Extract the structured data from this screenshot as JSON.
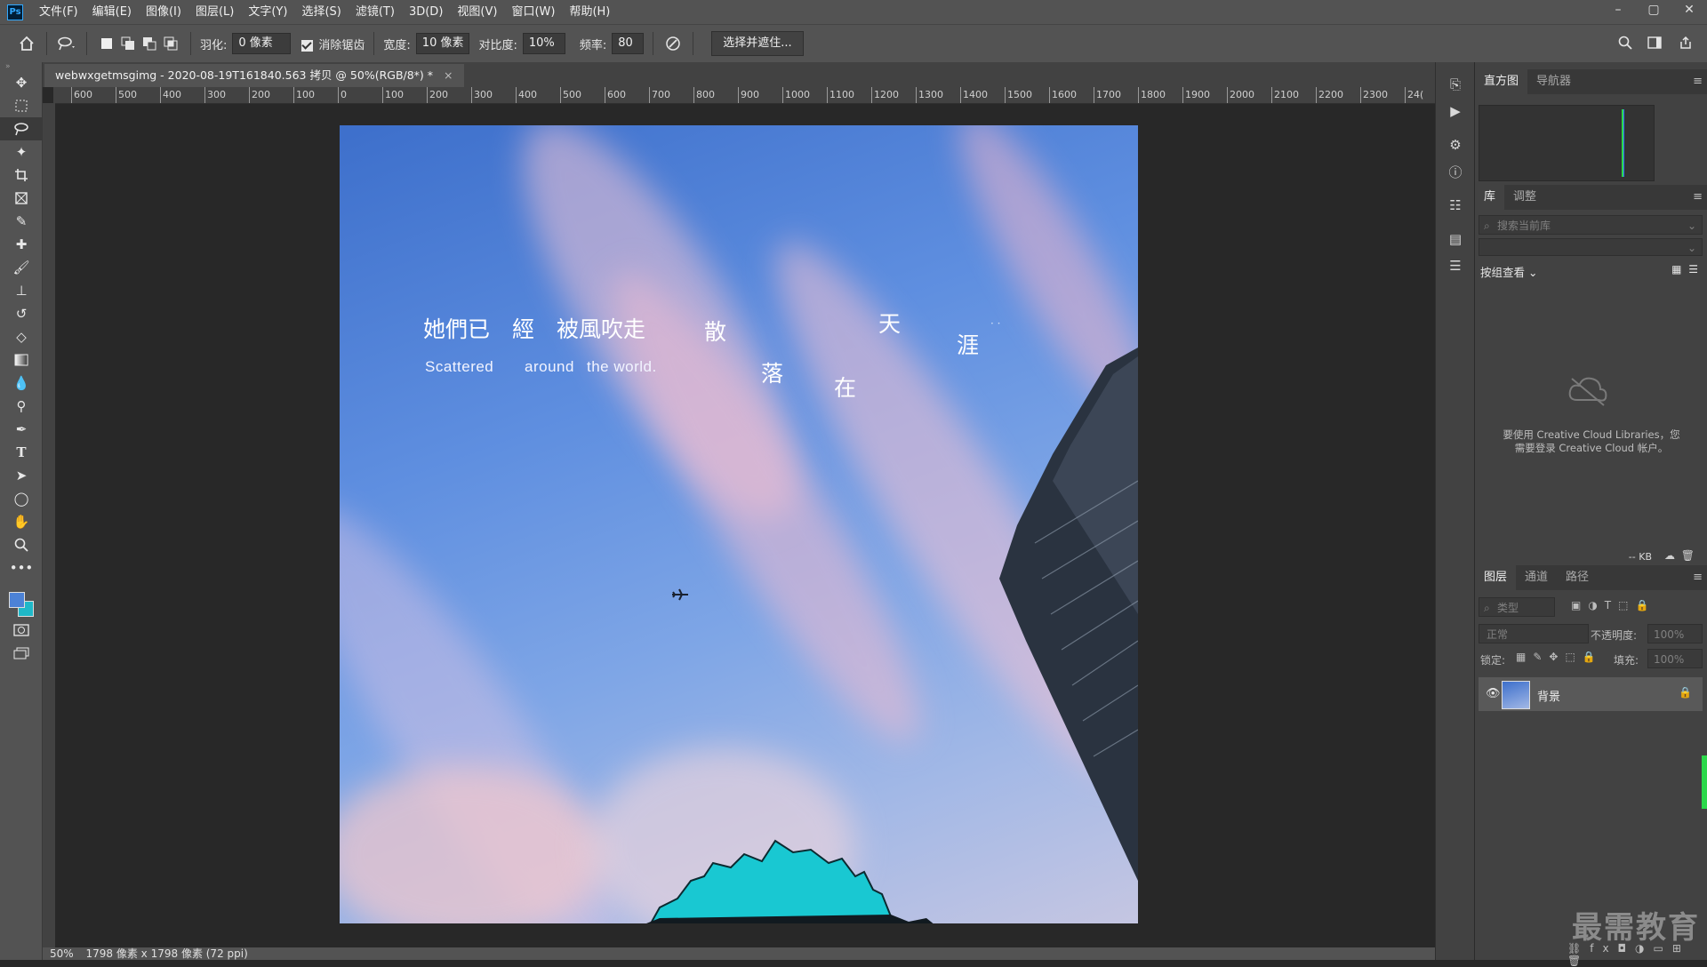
{
  "app": {
    "logo": "Ps"
  },
  "menubar": {
    "items": [
      "文件(F)",
      "编辑(E)",
      "图像(I)",
      "图层(L)",
      "文字(Y)",
      "选择(S)",
      "滤镜(T)",
      "3D(D)",
      "视图(V)",
      "窗口(W)",
      "帮助(H)"
    ],
    "window_buttons": [
      "–",
      "▢",
      "✕"
    ]
  },
  "options": {
    "feather_label": "羽化:",
    "feather_value": "0 像素",
    "antialias_label": "消除锯齿",
    "width_label": "宽度:",
    "width_value": "10 像素",
    "contrast_label": "对比度:",
    "contrast_value": "10%",
    "frequency_label": "频率:",
    "frequency_value": "80",
    "select_mask_button": "选择并遮住..."
  },
  "document": {
    "tab_title": "webwxgetmsgimg - 2020-08-19T161840.563 拷贝 @ 50%(RGB/8*) *",
    "tab_close": "×"
  },
  "ruler": {
    "top_labels": [
      "600",
      "500",
      "400",
      "300",
      "200",
      "100",
      "0",
      "100",
      "200",
      "300",
      "400",
      "500",
      "600",
      "700",
      "800",
      "900",
      "1000",
      "1100",
      "1200",
      "1300",
      "1400",
      "1500",
      "1600",
      "1700",
      "1800",
      "1900",
      "2000",
      "2100",
      "2200",
      "2300",
      "24("
    ]
  },
  "artwork": {
    "poem_cn_line1": "她們已　經　被風吹走",
    "poem_en_1": "Scattered",
    "poem_en_2": "around",
    "poem_en_3": "the world.",
    "char_san": "散",
    "char_luo": "落",
    "char_zai": "在",
    "char_tian": "天",
    "char_ya": "涯",
    "char_dots": "· ·",
    "colors": {
      "sky_top": "#3d6fcb",
      "selection_fill": "#19c8d2",
      "cloud_pink": "#e8b4c8"
    }
  },
  "status": {
    "zoom": "50%",
    "doc_info": "1798 像素 x 1798 像素 (72 ppi)"
  },
  "panels": {
    "top_tabs": [
      "直方图",
      "导航器"
    ],
    "library_tabs": [
      "库",
      "调整"
    ],
    "library_search_placeholder": "搜索当前库",
    "group_view": "按组查看",
    "cc_message_line1": "要使用 Creative Cloud Libraries，您",
    "cc_message_line2": "需要登录 Creative Cloud 帐户。",
    "kb_label": "-- KB",
    "layers_tabs": [
      "图层",
      "通道",
      "路径"
    ],
    "layer_filter": "类型",
    "blend_mode": "正常",
    "opacity_label": "不透明度:",
    "opacity_value": "100%",
    "lock_label": "锁定:",
    "fill_label": "填充:",
    "fill_value": "100%",
    "layer_name": "背景"
  },
  "watermark": "最需教育"
}
